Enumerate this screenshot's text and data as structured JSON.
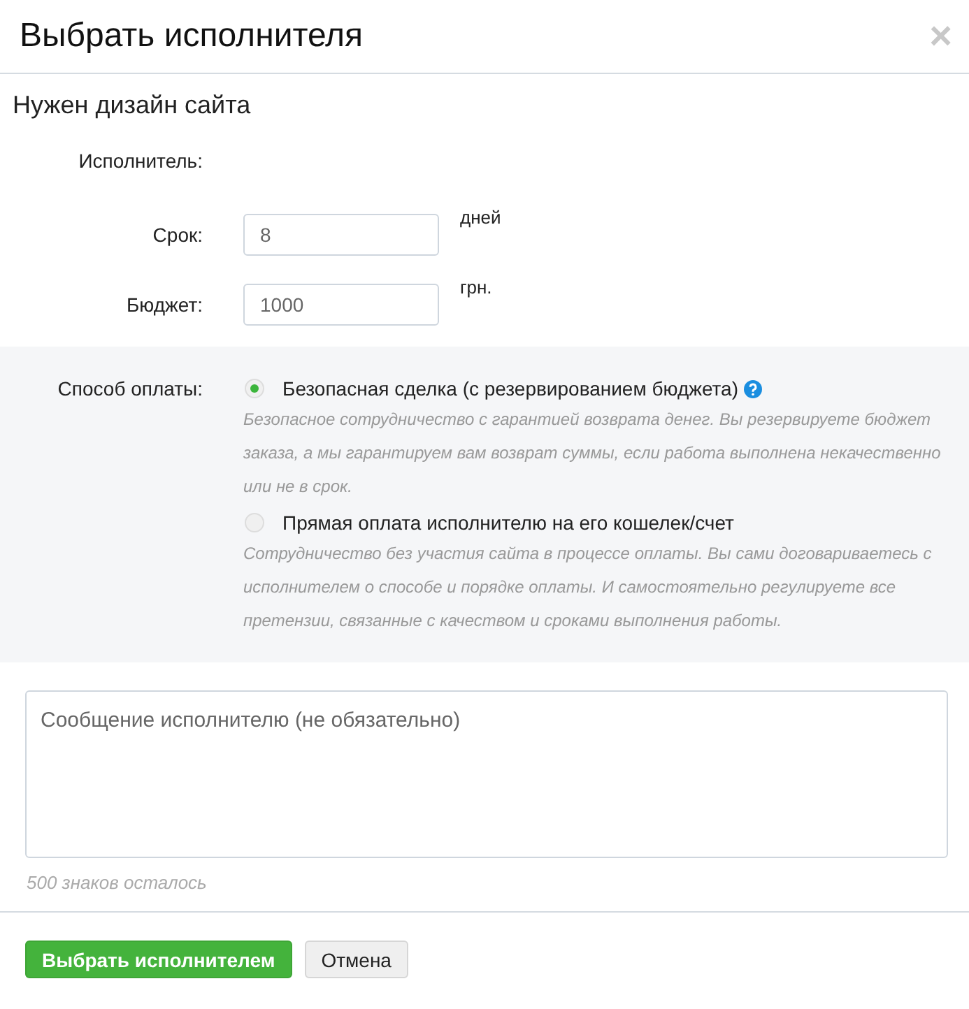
{
  "window": {
    "title": "Выбрать исполнителя",
    "close": "×"
  },
  "job_title": "Нужен дизайн сайта",
  "fields": [
    {
      "label": "Исполнитель:"
    },
    {
      "label": "Срок:",
      "value": "8",
      "unit": "дней"
    },
    {
      "label": "Бюджет:",
      "value": "1000",
      "unit": "грн."
    }
  ],
  "payment": {
    "label": "Способ оплаты:",
    "options": [
      {
        "label": "Безопасная сделка (с резервированием бюджета)",
        "help": true,
        "selected": true,
        "description": "Безопасное сотрудничество с гарантией возврата денег. Вы резервируете бюджет заказа, а мы гарантируем вам возврат суммы, если работа выполнена некачественно или не в срок."
      },
      {
        "label": "Прямая оплата исполнителю на его кошелек/счет",
        "help": false,
        "selected": false,
        "description": "Сотрудничество без участия сайта в процессе оплаты. Вы сами договариваетесь с исполнителем о способе и порядке оплаты. И самостоятельно регулируете все претензии, связанные с качеством и сроками выполнения работы."
      }
    ]
  },
  "message": {
    "placeholder": "Сообщение исполнителю (не обязательно)",
    "counter": "500 знаков осталось"
  },
  "buttons": [
    {
      "label": "Выбрать исполнителем",
      "kind": "primary"
    },
    {
      "label": "Отмена",
      "kind": "secondary"
    }
  ]
}
